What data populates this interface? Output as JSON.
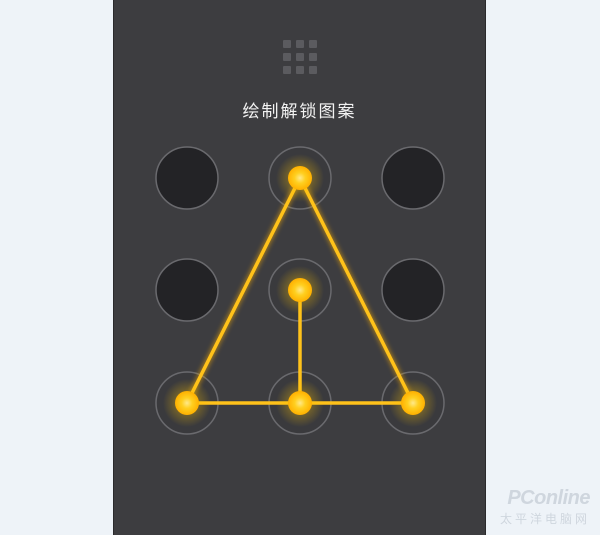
{
  "screen": {
    "title": "绘制解锁图案",
    "menu_icon": "grid-menu-icon"
  },
  "pattern": {
    "grid": "3x3",
    "selected_dots": [
      2,
      5,
      7,
      8,
      9
    ],
    "path_order": [
      2,
      7,
      8,
      9,
      2
    ],
    "extra_stroke": [
      5,
      8
    ],
    "line_color": "#ffc21a",
    "dot_glow_color": "#ffb800",
    "background_color": "#3d3d40"
  },
  "watermark": {
    "brand": "PConline",
    "subtitle": "太平洋电脑网"
  }
}
